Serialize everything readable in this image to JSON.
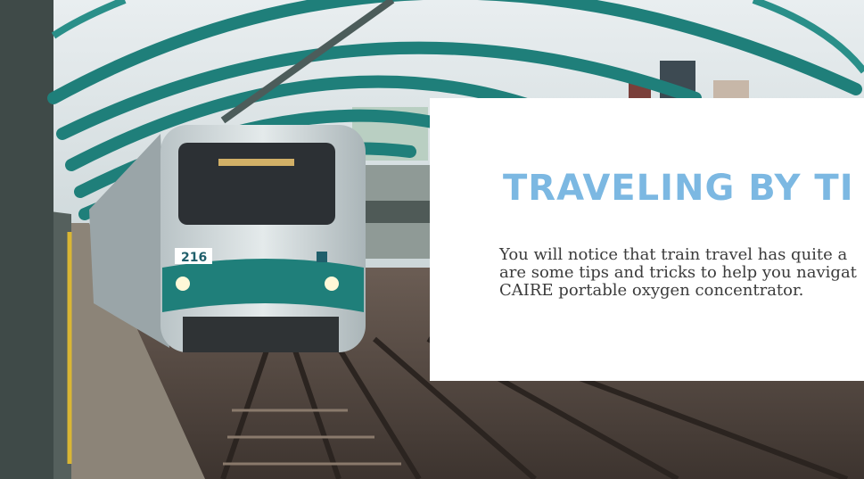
{
  "hero": {
    "train_number": "216",
    "colors": {
      "accent_teal": "#1f7f7a",
      "title_blue": "#7cb8e2"
    }
  },
  "card": {
    "title": "TRAVELING BY TI",
    "lines": [
      "You will notice that train travel has quite a",
      "are some tips and tricks to help you navigat",
      "CAIRE portable oxygen concentrator."
    ]
  }
}
